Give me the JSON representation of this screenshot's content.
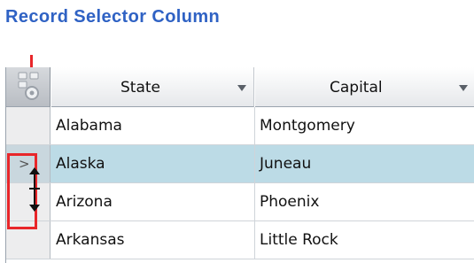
{
  "caption": "Record Selector Column",
  "grid": {
    "columns": [
      {
        "label": "State"
      },
      {
        "label": "Capital"
      }
    ],
    "rows": [
      {
        "state": "Alabama",
        "capital": "Montgomery",
        "selected": false
      },
      {
        "state": "Alaska",
        "capital": "Juneau",
        "selected": true
      },
      {
        "state": "Arizona",
        "capital": "Phoenix",
        "selected": false
      },
      {
        "state": "Arkansas",
        "capital": "Little Rock",
        "selected": false
      }
    ],
    "current_row_indicator": ">"
  },
  "colors": {
    "caption": "#2F62C4",
    "callout": "#E8262A",
    "selected_row": "#bcdbe6"
  },
  "icons": {
    "selector_header": "gear-icon",
    "column_menu": "dropdown-icon",
    "row_resize_cursor": "resize-icon"
  }
}
